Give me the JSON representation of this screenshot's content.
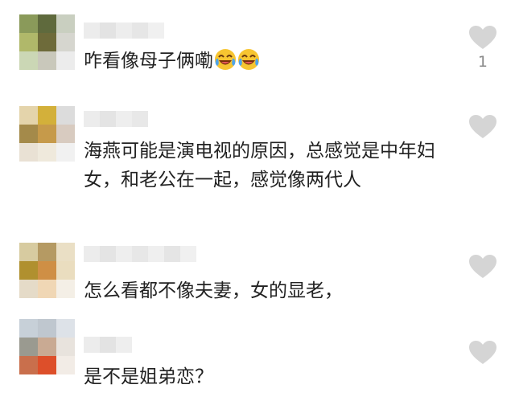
{
  "comments": [
    {
      "text": "咋看像母子俩嘞",
      "emojis": [
        "laughing-crying-emoji",
        "laughing-crying-emoji"
      ],
      "likes": "1",
      "avatar_colors": [
        "#8a9a5a",
        "#5f6a3d",
        "#c9cfc0",
        "#b0b86a",
        "#6e6b3a",
        "#d6d6cf",
        "#cbd7b5",
        "#c9c8bb",
        "#ececec"
      ]
    },
    {
      "text": "海燕可能是演电视的原因，总感觉是中年妇女，和老公在一起，感觉像两代人",
      "avatar_colors": [
        "#e4d4ab",
        "#d3b03a",
        "#dcdcdc",
        "#a48a4a",
        "#c69a4a",
        "#d8cbc0",
        "#e9e1d4",
        "#efe9dc",
        "#f1f1f1"
      ]
    },
    {
      "text": "怎么看都不像夫妻，女的显老，",
      "avatar_colors": [
        "#d7cba0",
        "#b59a63",
        "#eadfc5",
        "#b0902f",
        "#cf8f45",
        "#eaddbf",
        "#e5dbc8",
        "#f0d7b5",
        "#f4efe6"
      ]
    },
    {
      "text": "是不是姐弟恋？",
      "avatar_colors": [
        "#c7d0d8",
        "#bfc7cf",
        "#dde2e8",
        "#9a9a90",
        "#c9aa93",
        "#e8e3dd",
        "#c96f4c",
        "#dd4f2a",
        "#f2ece6"
      ]
    }
  ],
  "like_icon": "heart-icon",
  "colors": {
    "text": "#222222",
    "like_heart": "#d5d5d5",
    "like_count": "#8a8a8a"
  }
}
